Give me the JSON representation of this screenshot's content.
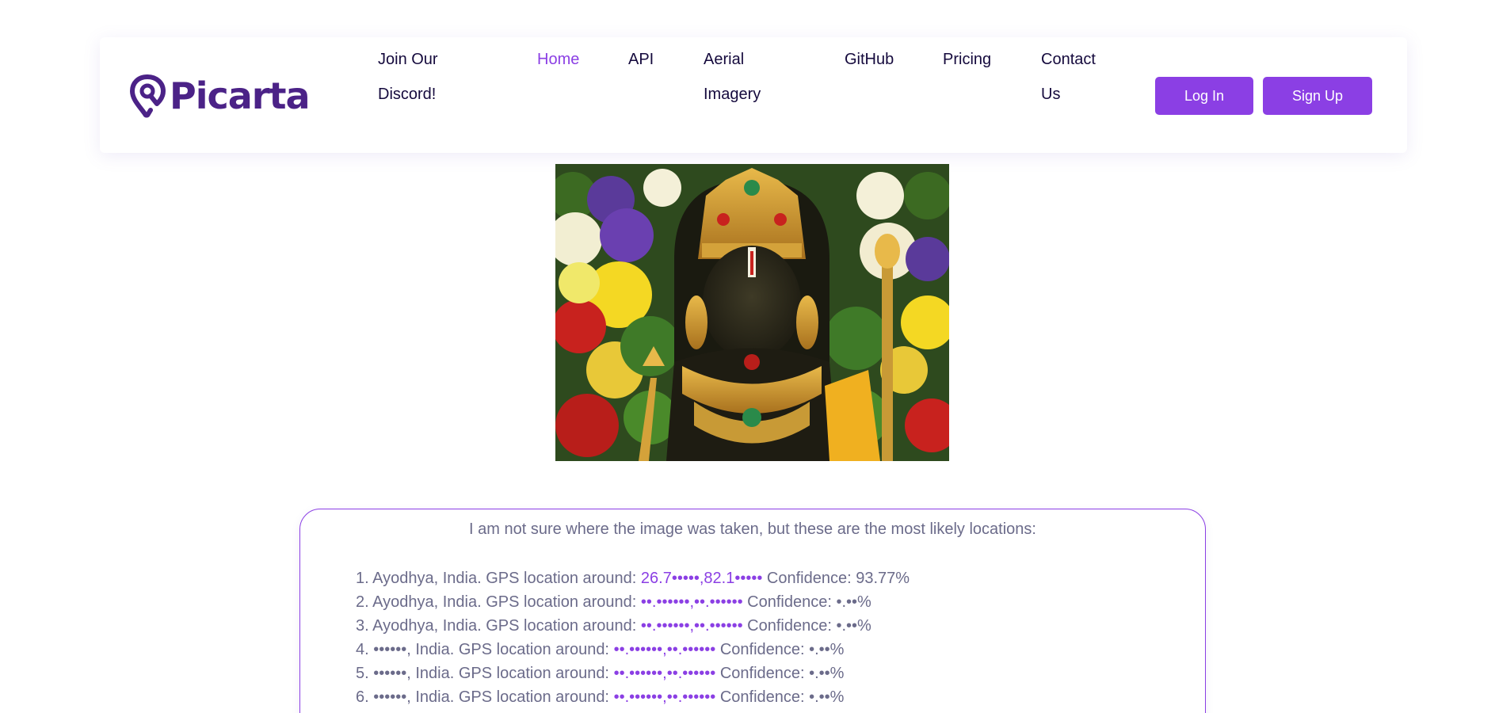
{
  "brand": {
    "name": "Picarta"
  },
  "nav": {
    "discord": "Join Our Discord!",
    "home": "Home",
    "api": "API",
    "aerial": "Aerial Imagery",
    "github": "GitHub",
    "pricing": "Pricing",
    "contact": "Contact Us"
  },
  "auth": {
    "login": "Log In",
    "signup": "Sign Up"
  },
  "colors": {
    "accent": "#8b3fe4",
    "brand": "#4b2287",
    "text": "#6b6b8a",
    "nav_text": "#150a3d"
  },
  "results": {
    "intro": "I am not sure where the image was taken, but these are the most likely locations:",
    "items": [
      {
        "num": "1.",
        "place": "Ayodhya, India.",
        "gps_label": "GPS location around:",
        "gps": "26.7•••••,82.1•••••",
        "confidence": "Confidence: 93.77%"
      },
      {
        "num": "2.",
        "place": "Ayodhya, India.",
        "gps_label": "GPS location around:",
        "gps": "••.••••••,••.••••••",
        "confidence": "Confidence: •.••%"
      },
      {
        "num": "3.",
        "place": "Ayodhya, India.",
        "gps_label": "GPS location around:",
        "gps": "••.••••••,••.••••••",
        "confidence": "Confidence: •.••%"
      },
      {
        "num": "4.",
        "place": "••••••, India.",
        "gps_label": "GPS location around:",
        "gps": "••.••••••,••.••••••",
        "confidence": "Confidence: •.••%"
      },
      {
        "num": "5.",
        "place": "••••••, India.",
        "gps_label": "GPS location around:",
        "gps": "••.••••••,••.••••••",
        "confidence": "Confidence: •.••%"
      },
      {
        "num": "6.",
        "place": "••••••, India.",
        "gps_label": "GPS location around:",
        "gps": "••.••••••,••.••••••",
        "confidence": "Confidence: •.••%"
      }
    ]
  }
}
